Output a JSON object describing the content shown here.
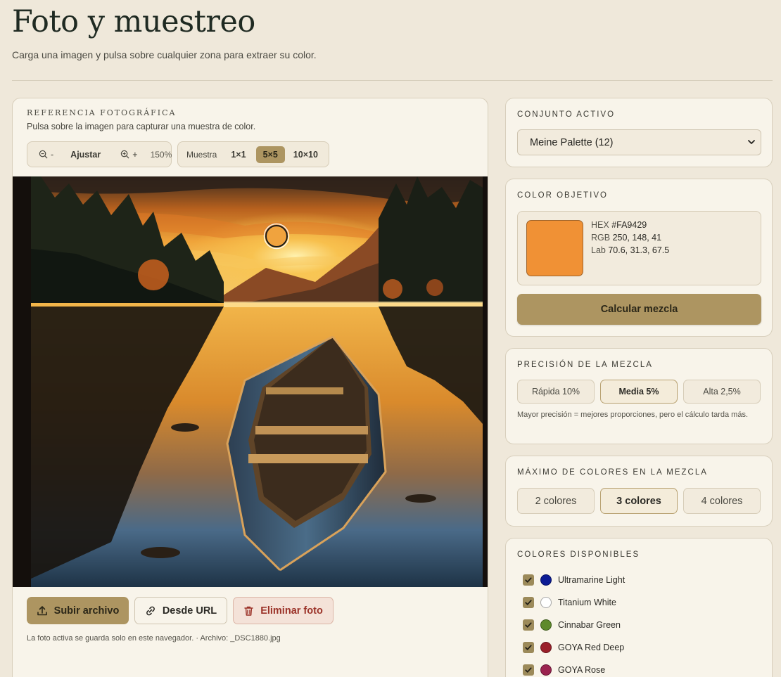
{
  "page": {
    "title": "Foto y muestreo",
    "subtitle": "Carga una imagen y pulsa sobre cualquier zona para extraer su color."
  },
  "photo_panel": {
    "heading": "REFERENCIA FOTOGRÁFICA",
    "hint": "Pulsa sobre la imagen para capturar una muestra de color.",
    "zoom_out_label": "-",
    "fit_label": "Ajustar",
    "zoom_in_label": "+",
    "zoom_value": "150%",
    "sample_label": "Muestra",
    "sample_sizes": [
      "1×1",
      "5×5",
      "10×10"
    ],
    "sample_selected": "5×5",
    "upload_label": "Subir archivo",
    "url_label": "Desde URL",
    "delete_label": "Eliminar foto",
    "file_note": "La foto activa se guarda solo en este navegador. · Archivo: _DSC1880.jpg"
  },
  "active_set": {
    "heading": "CONJUNTO ACTIVO",
    "selected": "Meine Palette (12)"
  },
  "target_color": {
    "heading": "COLOR OBJETIVO",
    "hex_label": "HEX",
    "hex": "#FA9429",
    "rgb_label": "RGB",
    "rgb": "250, 148, 41",
    "lab_label": "Lab",
    "lab": "70.6, 31.3, 67.5",
    "swatch_color": "#F09135",
    "calc_label": "Calcular mezcla"
  },
  "precision": {
    "heading": "PRECISIÓN DE LA MEZCLA",
    "options": [
      "Rápida 10%",
      "Media 5%",
      "Alta 2,5%"
    ],
    "selected": "Media 5%",
    "note": "Mayor precisión = mejores proporciones, pero el cálculo tarda más."
  },
  "max_colors": {
    "heading": "MÁXIMO DE COLORES EN LA MEZCLA",
    "options": [
      "2 colores",
      "3 colores",
      "4 colores"
    ],
    "selected": "3 colores"
  },
  "available": {
    "heading": "COLORES DISPONIBLES",
    "items": [
      {
        "name": "Ultramarine Light",
        "color": "#0c1b94",
        "checked": true
      },
      {
        "name": "Titanium White",
        "color": "#ffffff",
        "checked": true
      },
      {
        "name": "Cinnabar Green",
        "color": "#5e8a2c",
        "checked": true
      },
      {
        "name": "GOYA Red Deep",
        "color": "#9a1f2a",
        "checked": true
      },
      {
        "name": "GOYA Rose",
        "color": "#9b2350",
        "checked": true
      }
    ]
  },
  "colors": {
    "accent": "#AD9561",
    "background": "#EFE8DA",
    "card": "#F8F4EA",
    "danger_text": "#9B3228"
  }
}
